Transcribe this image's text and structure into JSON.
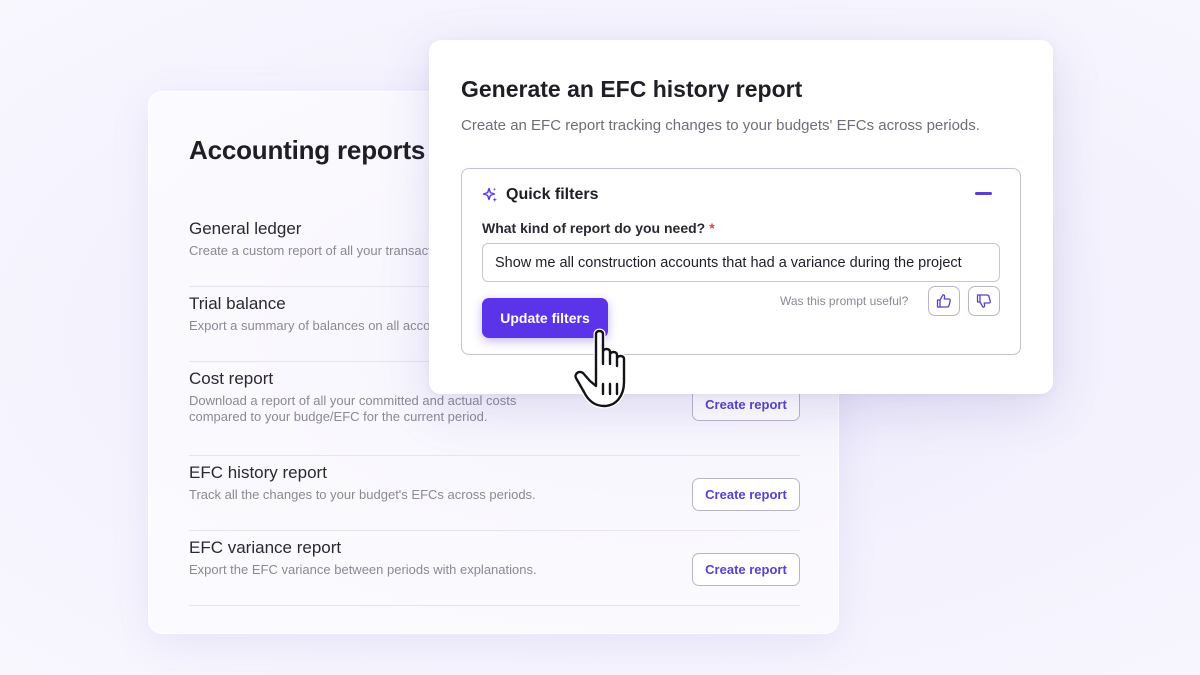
{
  "accounting_reports": {
    "title": "Accounting reports",
    "reports": [
      {
        "name": "General ledger",
        "description": "Create a custom report of all your transactions"
      },
      {
        "name": "Trial balance",
        "description": "Export a summary of balances on all accounts"
      },
      {
        "name": "Cost report",
        "description": "Download a report of all your committed and actual costs compared to your budge/EFC for the current period.",
        "button": "Create report"
      },
      {
        "name": "EFC history report",
        "description": "Track all the changes to your budget's EFCs across periods.",
        "button": "Create report"
      },
      {
        "name": "EFC variance report",
        "description": "Export the EFC variance between periods with explanations.",
        "button": "Create report"
      }
    ]
  },
  "modal": {
    "title": "Generate an EFC history report",
    "subtitle": "Create an EFC report tracking changes to your budgets' EFCs across periods.",
    "quick_filters": {
      "title": "Quick filters",
      "field_label": "What kind of report do you need?",
      "required_mark": "*",
      "prompt_value": "Show me all construction accounts that had a variance during the project",
      "update_button": "Update filters",
      "feedback_question": "Was this prompt useful?"
    }
  },
  "colors": {
    "accent": "#5b33e8",
    "accent_text": "#5a3fd1",
    "required": "#e0473d"
  },
  "icons": {
    "quick_filters": "sparkle-icon",
    "collapse": "minus-icon",
    "thumbs_up": "thumbs-up-icon",
    "thumbs_down": "thumbs-down-icon",
    "cursor": "hand-pointer-icon"
  }
}
